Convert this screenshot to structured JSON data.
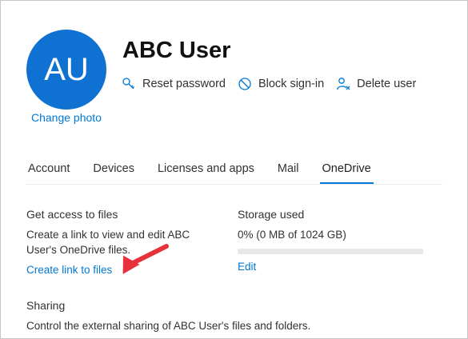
{
  "avatar": {
    "initials": "AU"
  },
  "change_photo": "Change photo",
  "user": {
    "name": "ABC User"
  },
  "actions": {
    "reset_password": "Reset password",
    "block_sign_in": "Block sign-in",
    "delete_user": "Delete user"
  },
  "tabs": [
    {
      "label": "Account"
    },
    {
      "label": "Devices"
    },
    {
      "label": "Licenses and apps"
    },
    {
      "label": "Mail"
    },
    {
      "label": "OneDrive",
      "active": true
    }
  ],
  "get_access": {
    "title": "Get access to files",
    "description": "Create a link to view and edit ABC User's OneDrive files.",
    "link": "Create link to files"
  },
  "storage": {
    "title": "Storage used",
    "usage_text": "0% (0 MB of 1024 GB)",
    "used_fraction": 0,
    "edit_link": "Edit"
  },
  "sharing": {
    "title": "Sharing",
    "description": "Control the external sharing of ABC User's files and folders."
  },
  "colors": {
    "accent": "#0078d4",
    "avatar_bg": "#0f72d2",
    "annotation_arrow": "#e8313a"
  }
}
